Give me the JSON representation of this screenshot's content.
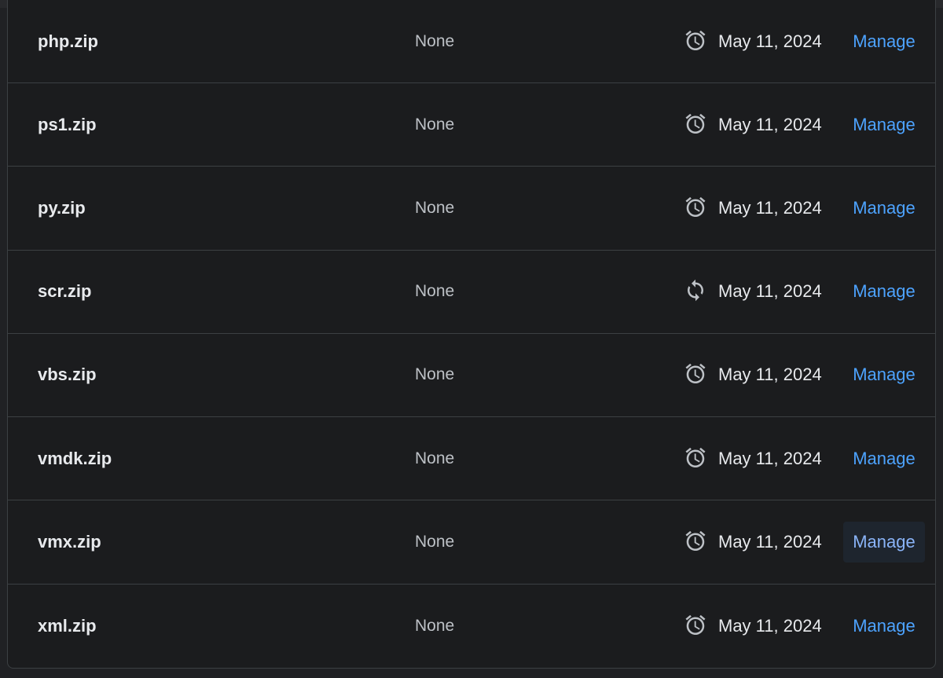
{
  "rows": [
    {
      "name": "php.zip",
      "type": "None",
      "status_icon": "alarm-icon",
      "date": "May 11, 2024",
      "action": "Manage"
    },
    {
      "name": "ps1.zip",
      "type": "None",
      "status_icon": "alarm-icon",
      "date": "May 11, 2024",
      "action": "Manage"
    },
    {
      "name": "py.zip",
      "type": "None",
      "status_icon": "alarm-icon",
      "date": "May 11, 2024",
      "action": "Manage"
    },
    {
      "name": "scr.zip",
      "type": "None",
      "status_icon": "sync-icon",
      "date": "May 11, 2024",
      "action": "Manage"
    },
    {
      "name": "vbs.zip",
      "type": "None",
      "status_icon": "alarm-icon",
      "date": "May 11, 2024",
      "action": "Manage"
    },
    {
      "name": "vmdk.zip",
      "type": "None",
      "status_icon": "alarm-icon",
      "date": "May 11, 2024",
      "action": "Manage"
    },
    {
      "name": "vmx.zip",
      "type": "None",
      "status_icon": "alarm-icon",
      "date": "May 11, 2024",
      "action": "Manage",
      "hovered": true
    },
    {
      "name": "xml.zip",
      "type": "None",
      "status_icon": "alarm-icon",
      "date": "May 11, 2024",
      "action": "Manage"
    }
  ],
  "colors": {
    "background": "#1b1c1e",
    "divider": "#3c4043",
    "text_primary": "#e8eaed",
    "text_secondary": "#bdc1c6",
    "link": "#4da3ff"
  }
}
